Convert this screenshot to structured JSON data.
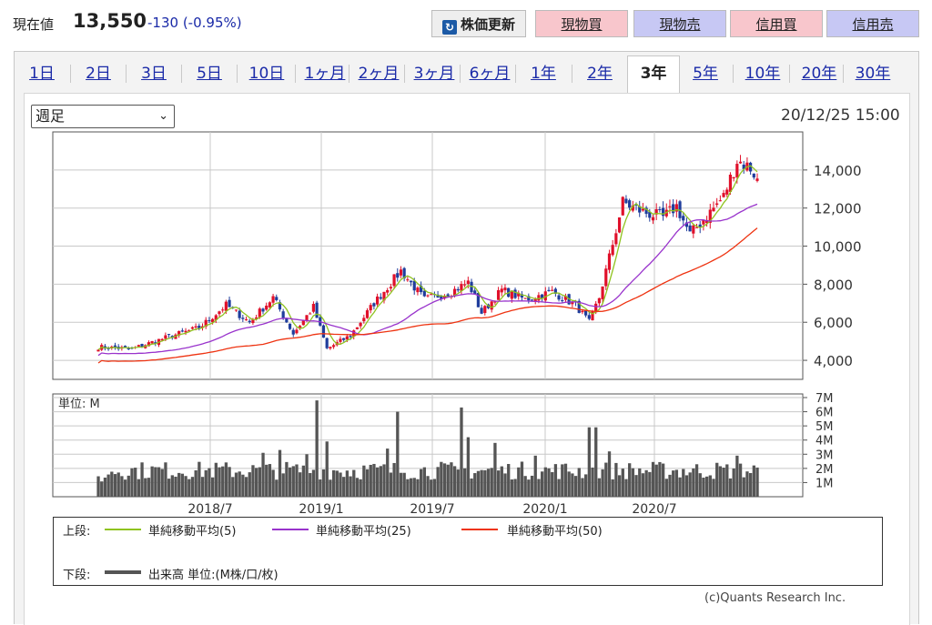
{
  "quote": {
    "label": "現在値",
    "price": "13,550",
    "change": "-130",
    "change_pct": "(-0.95%)"
  },
  "buttons": {
    "refresh": "株価更新",
    "cash_buy": "現物買",
    "cash_sell": "現物売",
    "margin_buy": "信用買",
    "margin_sell": "信用売"
  },
  "tabs": [
    "1日",
    "2日",
    "3日",
    "5日",
    "10日",
    "1ヶ月",
    "2ヶ月",
    "3ヶ月",
    "6ヶ月",
    "1年",
    "2年",
    "3年",
    "5年",
    "10年",
    "20年",
    "30年"
  ],
  "active_tab": "3年",
  "period_select": {
    "value": "週足"
  },
  "timestamp": "20/12/25 15:00",
  "colors": {
    "up": "#e0102a",
    "down": "#1f3d9c",
    "ma5": "#8fc31f",
    "ma25": "#9933cc",
    "ma50": "#ee3311",
    "volume": "#555555"
  },
  "chart_data": [
    {
      "type": "candlestick",
      "x_tick_labels": [
        "2018/7",
        "2019/1",
        "2019/7",
        "2020/1",
        "2020/7"
      ],
      "y_tick_labels": [
        "4,000",
        "6,000",
        "8,000",
        "10,000",
        "12,000",
        "14,000"
      ],
      "ylim": [
        3000,
        16000
      ],
      "grid": true,
      "series": [
        {
          "name": "単純移動平均(5)",
          "kind": "ma5"
        },
        {
          "name": "単純移動平均(25)",
          "kind": "ma25"
        },
        {
          "name": "単純移動平均(50)",
          "kind": "ma50"
        }
      ],
      "close_waypoints": [
        {
          "week": 0,
          "value": 4700
        },
        {
          "week": 10,
          "value": 4600
        },
        {
          "week": 22,
          "value": 5300
        },
        {
          "week": 30,
          "value": 5700
        },
        {
          "week": 38,
          "value": 6900
        },
        {
          "week": 45,
          "value": 6000
        },
        {
          "week": 52,
          "value": 7300
        },
        {
          "week": 58,
          "value": 5400
        },
        {
          "week": 64,
          "value": 6800
        },
        {
          "week": 68,
          "value": 4600
        },
        {
          "week": 75,
          "value": 5300
        },
        {
          "week": 82,
          "value": 7000
        },
        {
          "week": 90,
          "value": 8700
        },
        {
          "week": 97,
          "value": 7200
        },
        {
          "week": 105,
          "value": 7600
        },
        {
          "week": 110,
          "value": 8100
        },
        {
          "week": 114,
          "value": 6500
        },
        {
          "week": 120,
          "value": 7700
        },
        {
          "week": 127,
          "value": 7200
        },
        {
          "week": 135,
          "value": 7600
        },
        {
          "week": 142,
          "value": 6900
        },
        {
          "week": 146,
          "value": 6000
        },
        {
          "week": 149,
          "value": 7300
        },
        {
          "week": 152,
          "value": 9400
        },
        {
          "week": 156,
          "value": 12300
        },
        {
          "week": 162,
          "value": 11800
        },
        {
          "week": 168,
          "value": 11500
        },
        {
          "week": 172,
          "value": 12100
        },
        {
          "week": 176,
          "value": 10600
        },
        {
          "week": 182,
          "value": 11800
        },
        {
          "week": 186,
          "value": 12600
        },
        {
          "week": 190,
          "value": 14500
        },
        {
          "week": 194,
          "value": 14100
        },
        {
          "week": 196,
          "value": 13550
        }
      ]
    },
    {
      "type": "bar",
      "title": "単位: M",
      "y_tick_labels": [
        "1M",
        "2M",
        "3M",
        "4M",
        "5M",
        "6M",
        "7M"
      ],
      "ylim": [
        0,
        7
      ],
      "spike_weeks": [
        {
          "week": 49,
          "value": 3.1
        },
        {
          "week": 54,
          "value": 3.3
        },
        {
          "week": 62,
          "value": 3.0
        },
        {
          "week": 65,
          "value": 6.8
        },
        {
          "week": 68,
          "value": 3.9
        },
        {
          "week": 86,
          "value": 3.4
        },
        {
          "week": 89,
          "value": 6.0
        },
        {
          "week": 108,
          "value": 6.3
        },
        {
          "week": 110,
          "value": 4.2
        },
        {
          "week": 118,
          "value": 3.8
        },
        {
          "week": 130,
          "value": 2.9
        },
        {
          "week": 146,
          "value": 4.9
        },
        {
          "week": 148,
          "value": 4.9
        },
        {
          "week": 152,
          "value": 3.2
        },
        {
          "week": 190,
          "value": 2.9
        }
      ]
    }
  ],
  "legend": {
    "upper_label": "上段:",
    "lower_label": "下段:",
    "ma5": "単純移動平均(5)",
    "ma25": "単純移動平均(25)",
    "ma50": "単純移動平均(50)",
    "volume": "出来高 単位:(M株/口/枚)"
  },
  "copyright": "(c)Quants Research Inc."
}
